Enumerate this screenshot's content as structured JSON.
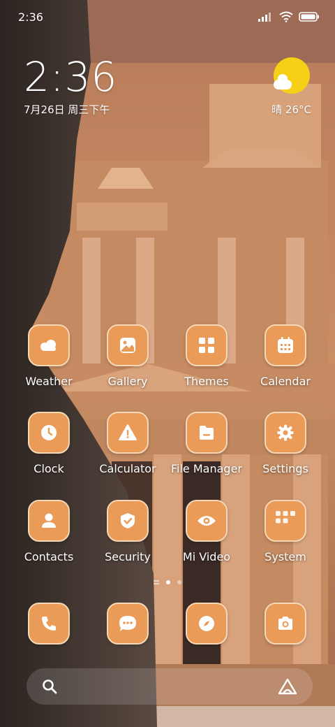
{
  "status_bar": {
    "time": "2:36"
  },
  "clock": {
    "time": "2:36",
    "date": "7月26日 周三下午"
  },
  "weather": {
    "text": "晴 26°C"
  },
  "apps": [
    {
      "label": "Weather",
      "icon": "weather-icon"
    },
    {
      "label": "Gallery",
      "icon": "gallery-icon"
    },
    {
      "label": "Themes",
      "icon": "themes-icon"
    },
    {
      "label": "Calendar",
      "icon": "calendar-icon"
    },
    {
      "label": "Clock",
      "icon": "clock-icon"
    },
    {
      "label": "Calculator",
      "icon": "calculator-icon"
    },
    {
      "label": "File Manager",
      "icon": "file-manager-icon"
    },
    {
      "label": "Settings",
      "icon": "settings-icon"
    },
    {
      "label": "Contacts",
      "icon": "contacts-icon"
    },
    {
      "label": "Security",
      "icon": "security-icon"
    },
    {
      "label": "Mi Video",
      "icon": "video-icon"
    },
    {
      "label": "System",
      "icon": "folder-icon"
    }
  ],
  "dock": [
    {
      "icon": "phone-icon"
    },
    {
      "icon": "messages-icon"
    },
    {
      "icon": "browser-icon"
    },
    {
      "icon": "camera-icon"
    }
  ],
  "colors": {
    "icon_bg": "#e99b57",
    "icon_border": "#f6d8b7",
    "sun": "#f6d016"
  }
}
